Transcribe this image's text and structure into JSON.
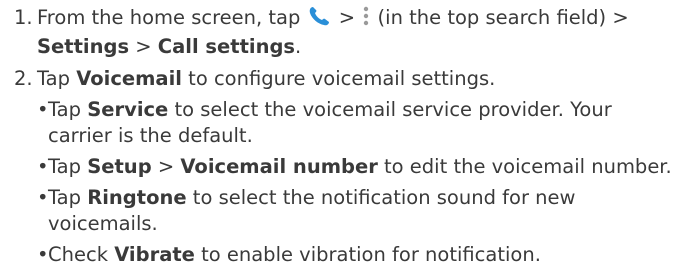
{
  "steps": [
    {
      "number": "1.",
      "line1_before_phone": "From the home screen, tap",
      "line1_gt1": " > ",
      "line1_after_menu": " (in the top search field) >",
      "settings": "Settings",
      "gt2": " > ",
      "call_settings": "Call settings",
      "period": ".",
      "phone_icon": "phone-icon",
      "menu_icon": "vertical-dots-menu-icon",
      "accent_color": "#2a8fd8"
    },
    {
      "number": "2.",
      "tap": "Tap ",
      "voicemail": "Voicemail",
      "rest": " to configure voicemail settings."
    }
  ],
  "bullets": [
    {
      "tap": "Tap ",
      "bold": "Service",
      "rest_line1": " to select the voicemail service provider. Your",
      "rest_line2": "carrier is the default."
    },
    {
      "tap": "Tap ",
      "bold1": "Setup",
      "gt": " > ",
      "bold2": "Voicemail number",
      "rest": " to edit the voicemail number."
    },
    {
      "tap": "Tap ",
      "bold": "Ringtone",
      "rest_line1": " to select the notification sound for new",
      "rest_line2": "voicemails."
    },
    {
      "tap": "Check ",
      "bold": "Vibrate",
      "rest": " to enable vibration for notification."
    }
  ],
  "bullet_char": "•"
}
